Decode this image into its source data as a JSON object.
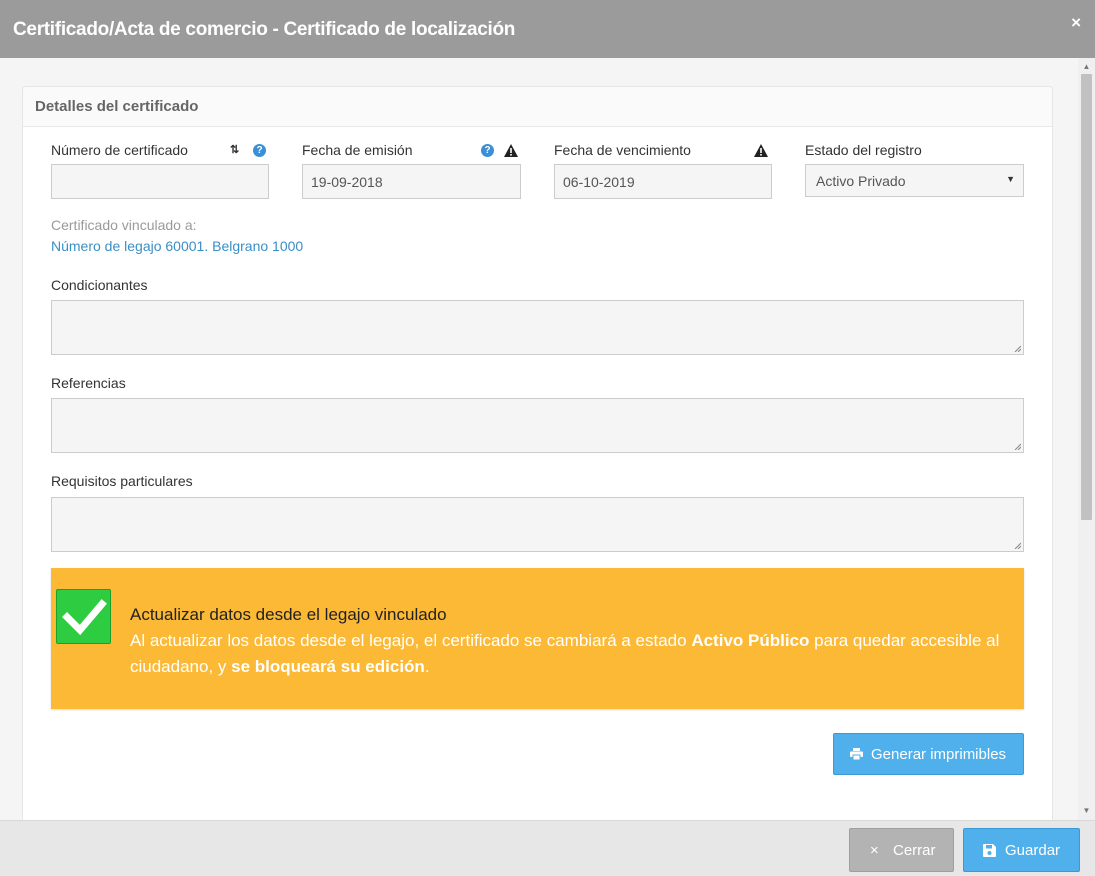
{
  "window": {
    "title": "Certificado/Acta de comercio - Certificado de localización",
    "close_glyph": "×"
  },
  "panel": {
    "title": "Detalles del certificado"
  },
  "fields": {
    "numero": {
      "label": "Número de certificado",
      "value": ""
    },
    "emision": {
      "label": "Fecha de emisión",
      "value": "19-09-2018"
    },
    "vencimiento": {
      "label": "Fecha de vencimiento",
      "value": "06-10-2019"
    },
    "estado": {
      "label": "Estado del registro",
      "value": "Activo Privado"
    }
  },
  "vinculado": {
    "label": "Certificado vinculado a:",
    "link": "Número de legajo 60001. Belgrano 1000"
  },
  "textareas": {
    "condicionantes": "Condicionantes",
    "referencias": "Referencias",
    "requisitos": "Requisitos particulares"
  },
  "alert": {
    "checked": true,
    "title": "Actualizar datos desde el legajo vinculado",
    "body_1": "Al actualizar los datos desde el legajo, el certificado se cambiará a estado ",
    "body_bold_1": "Activo Público",
    "body_2": " para quedar accesible al ciudadano, y ",
    "body_bold_2": "se bloqueará su edición",
    "body_3": ".",
    "color": "#fbb936"
  },
  "buttons": {
    "generar": "Generar imprimibles",
    "cerrar": "Cerrar",
    "guardar": "Guardar"
  },
  "icons": {
    "close": "close-icon",
    "sort": "sort-icon",
    "help": "help-icon",
    "warning": "warning-icon",
    "dropdown": "chevron-down-icon",
    "check": "check-icon",
    "print": "print-icon",
    "cancel": "x-icon",
    "save": "floppy-icon"
  },
  "colors": {
    "titlebar": "#9b9b9b",
    "primary": "#4fb0ec",
    "secondary": "#b3b3b3",
    "link": "#3a8fc6",
    "check": "#2ecc40"
  }
}
